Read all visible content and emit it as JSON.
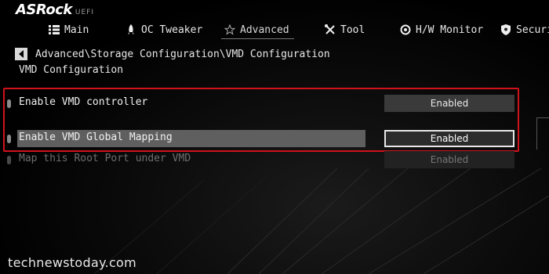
{
  "brand": {
    "name": "ASRock",
    "sub": "UEFI"
  },
  "tabs": [
    {
      "label": "Main",
      "icon": "list-icon"
    },
    {
      "label": "OC Tweaker",
      "icon": "rocket-icon"
    },
    {
      "label": "Advanced",
      "icon": "star-icon",
      "active": true
    },
    {
      "label": "Tool",
      "icon": "tools-icon"
    },
    {
      "label": "H/W Monitor",
      "icon": "monitor-icon"
    },
    {
      "label": "Securit",
      "icon": "security-icon"
    }
  ],
  "breadcrumb": {
    "path": "Advanced\\Storage Configuration\\VMD Configuration"
  },
  "section_title": "VMD Configuration",
  "settings": [
    {
      "label": "Enable VMD controller",
      "value": "Enabled"
    },
    {
      "label": "Enable VMD Global Mapping",
      "value": "Enabled",
      "selected": true
    },
    {
      "label": "Map this Root Port under VMD",
      "value": "Enabled",
      "disabled": true
    }
  ],
  "watermark": "technewstoday.com",
  "colors": {
    "highlight_border": "#d0121b",
    "selected_row": "#5f5f5f"
  }
}
